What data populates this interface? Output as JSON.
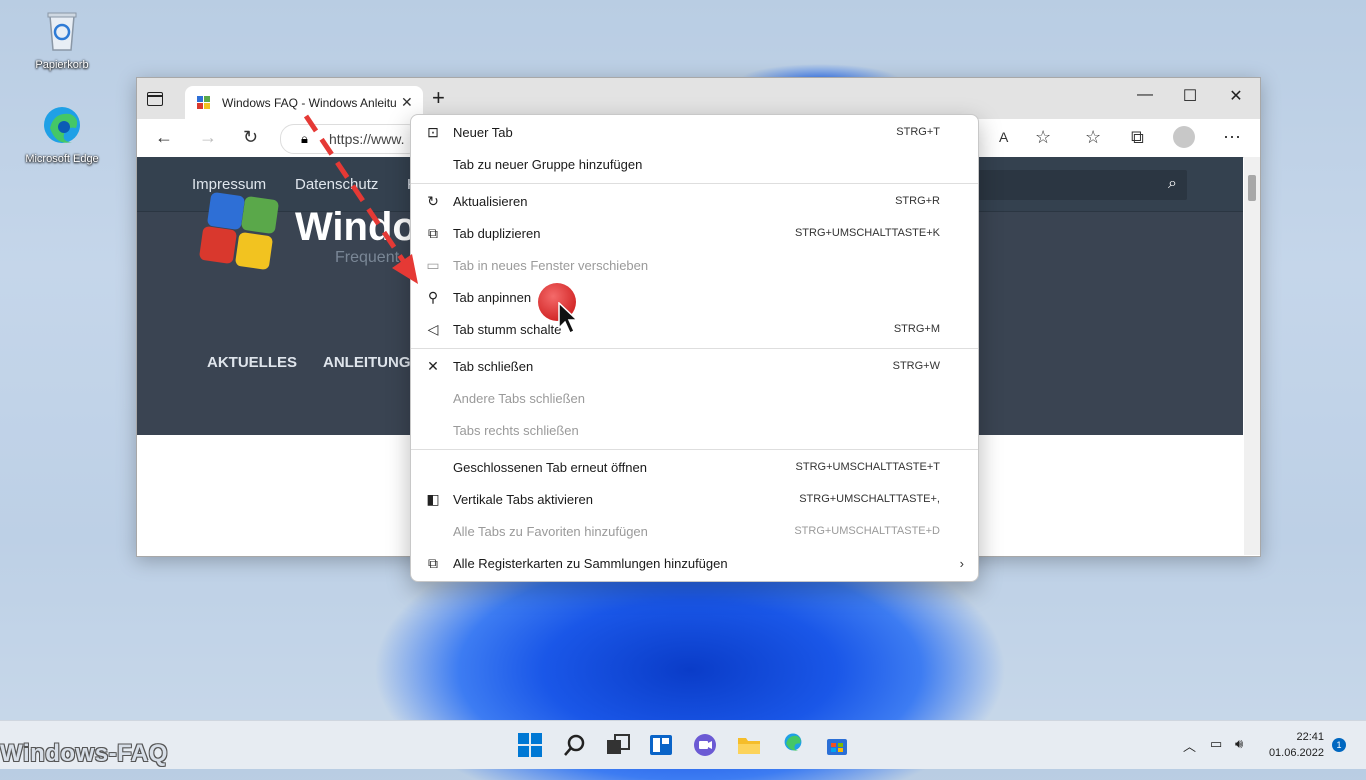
{
  "desktop": {
    "recycle_bin": "Papierkorb",
    "edge": "Microsoft Edge",
    "watermark": "Windows-FAQ"
  },
  "browser": {
    "tab_title": "Windows FAQ - Windows Anleitu",
    "tab_close": "✕",
    "new_tab": "+",
    "url": "https://www.",
    "controls": {
      "minimize": "—",
      "maximize": "☐",
      "close": "✕"
    }
  },
  "site": {
    "nav": [
      "Impressum",
      "Datenschutz",
      "K"
    ],
    "logo_text": "Windo",
    "logo_sub": "Frequent",
    "menu": [
      "AKTUELLES",
      "ANLEITUNG"
    ]
  },
  "context_menu": {
    "items": [
      {
        "label": "Neuer Tab",
        "shortcut": "STRG+T",
        "icon": "new-tab-icon",
        "disabled": false
      },
      {
        "label": "Tab zu neuer Gruppe hinzufügen",
        "shortcut": "",
        "icon": "",
        "disabled": false
      },
      {
        "label": "Aktualisieren",
        "shortcut": "STRG+R",
        "icon": "refresh-icon",
        "disabled": false
      },
      {
        "label": "Tab duplizieren",
        "shortcut": "STRG+UMSCHALTTASTE+K",
        "icon": "duplicate-icon",
        "disabled": false
      },
      {
        "label": "Tab in neues Fenster verschieben",
        "shortcut": "",
        "icon": "window-icon",
        "disabled": true
      },
      {
        "label": "Tab anpinnen",
        "shortcut": "",
        "icon": "pin-icon",
        "disabled": false
      },
      {
        "label": "Tab stumm schalte",
        "shortcut": "STRG+M",
        "icon": "mute-icon",
        "disabled": false
      },
      {
        "label": "Tab schließen",
        "shortcut": "STRG+W",
        "icon": "close-icon",
        "disabled": false
      },
      {
        "label": "Andere Tabs schließen",
        "shortcut": "",
        "icon": "",
        "disabled": true
      },
      {
        "label": "Tabs rechts schließen",
        "shortcut": "",
        "icon": "",
        "disabled": true
      },
      {
        "label": "Geschlossenen Tab erneut öffnen",
        "shortcut": "STRG+UMSCHALTTASTE+T",
        "icon": "",
        "disabled": false
      },
      {
        "label": "Vertikale Tabs aktivieren",
        "shortcut": "STRG+UMSCHALTTASTE+,",
        "icon": "vertical-tabs-icon",
        "disabled": false
      },
      {
        "label": "Alle Tabs zu Favoriten hinzufügen",
        "shortcut": "STRG+UMSCHALTTASTE+D",
        "icon": "",
        "disabled": true
      },
      {
        "label": "Alle Registerkarten zu Sammlungen hinzufügen",
        "shortcut": "",
        "icon": "collections-icon",
        "disabled": false
      }
    ]
  },
  "taskbar": {
    "time": "22:41",
    "date": "01.06.2022",
    "notifications": "1"
  }
}
